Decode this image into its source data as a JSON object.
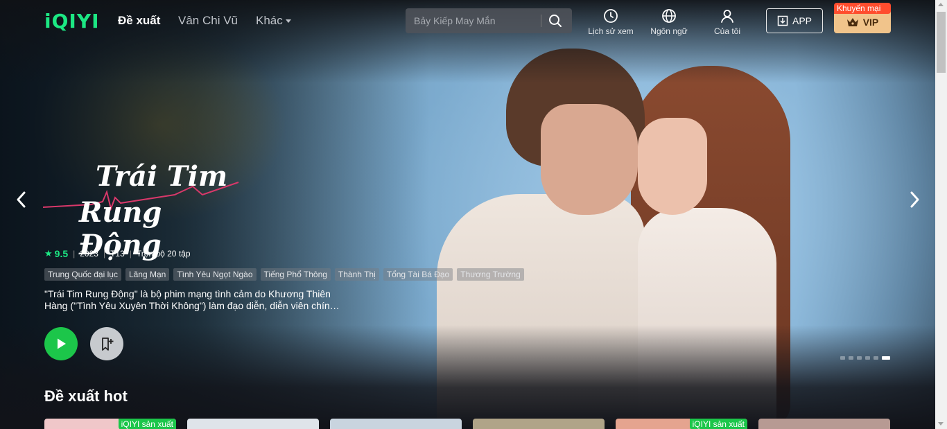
{
  "brand": {
    "logo": "iQIYI",
    "accent": "#1ce783"
  },
  "nav": {
    "items": [
      {
        "label": "Đề xuất",
        "active": true
      },
      {
        "label": "Vân Chi Vũ",
        "active": false
      },
      {
        "label": "Khác",
        "active": false
      }
    ]
  },
  "search": {
    "placeholder": "Bảy Kiếp May Mắn"
  },
  "header_actions": {
    "history": "Lịch sử xem",
    "language": "Ngôn ngữ",
    "account": "Của tôi",
    "app": "APP",
    "vip": "VIP",
    "vip_promo": "Khuyến mại"
  },
  "hero": {
    "title_line1": "Trái Tim",
    "title_line2": "Rung Động",
    "rating": "9.5",
    "year": "2023",
    "age": "T13",
    "episodes": "Trọn bộ 20 tập",
    "tags": [
      "Trung Quốc đại lục",
      "Lãng Mạn",
      "Tình Yêu Ngọt Ngào",
      "Tiếng Phổ Thông",
      "Thành Thị",
      "Tổng Tài Bá Đạo",
      "Thương Trường"
    ],
    "description": "\"Trái Tim Rung Động\" là bộ phim mạng tình cảm do Khương Thiên Hàng (\"Tình Yêu Xuyên Thời Không\") làm đạo diễn, diễn viên chín…",
    "carousel_total": 6,
    "carousel_active_index": 5
  },
  "section": {
    "title": "Đề xuất hot",
    "cards": [
      {
        "badge": "iQIYI sản xuất",
        "color": "#f0c7c9"
      },
      {
        "badge": "",
        "color": "#dfe4ea"
      },
      {
        "badge": "",
        "color": "#c9d4df"
      },
      {
        "badge": "",
        "color": "#b0a488"
      },
      {
        "badge": "iQIYI sản xuất",
        "color": "#e5a48f"
      },
      {
        "badge": "",
        "color": "#b79a93"
      }
    ]
  },
  "icons": {
    "search": "search-icon",
    "history": "clock-icon",
    "language": "globe-icon",
    "account": "user-icon",
    "app": "download-icon",
    "vip": "crown-icon",
    "play": "play-icon",
    "save": "bookmark-add-icon",
    "prev": "chevron-left-icon",
    "next": "chevron-right-icon"
  }
}
